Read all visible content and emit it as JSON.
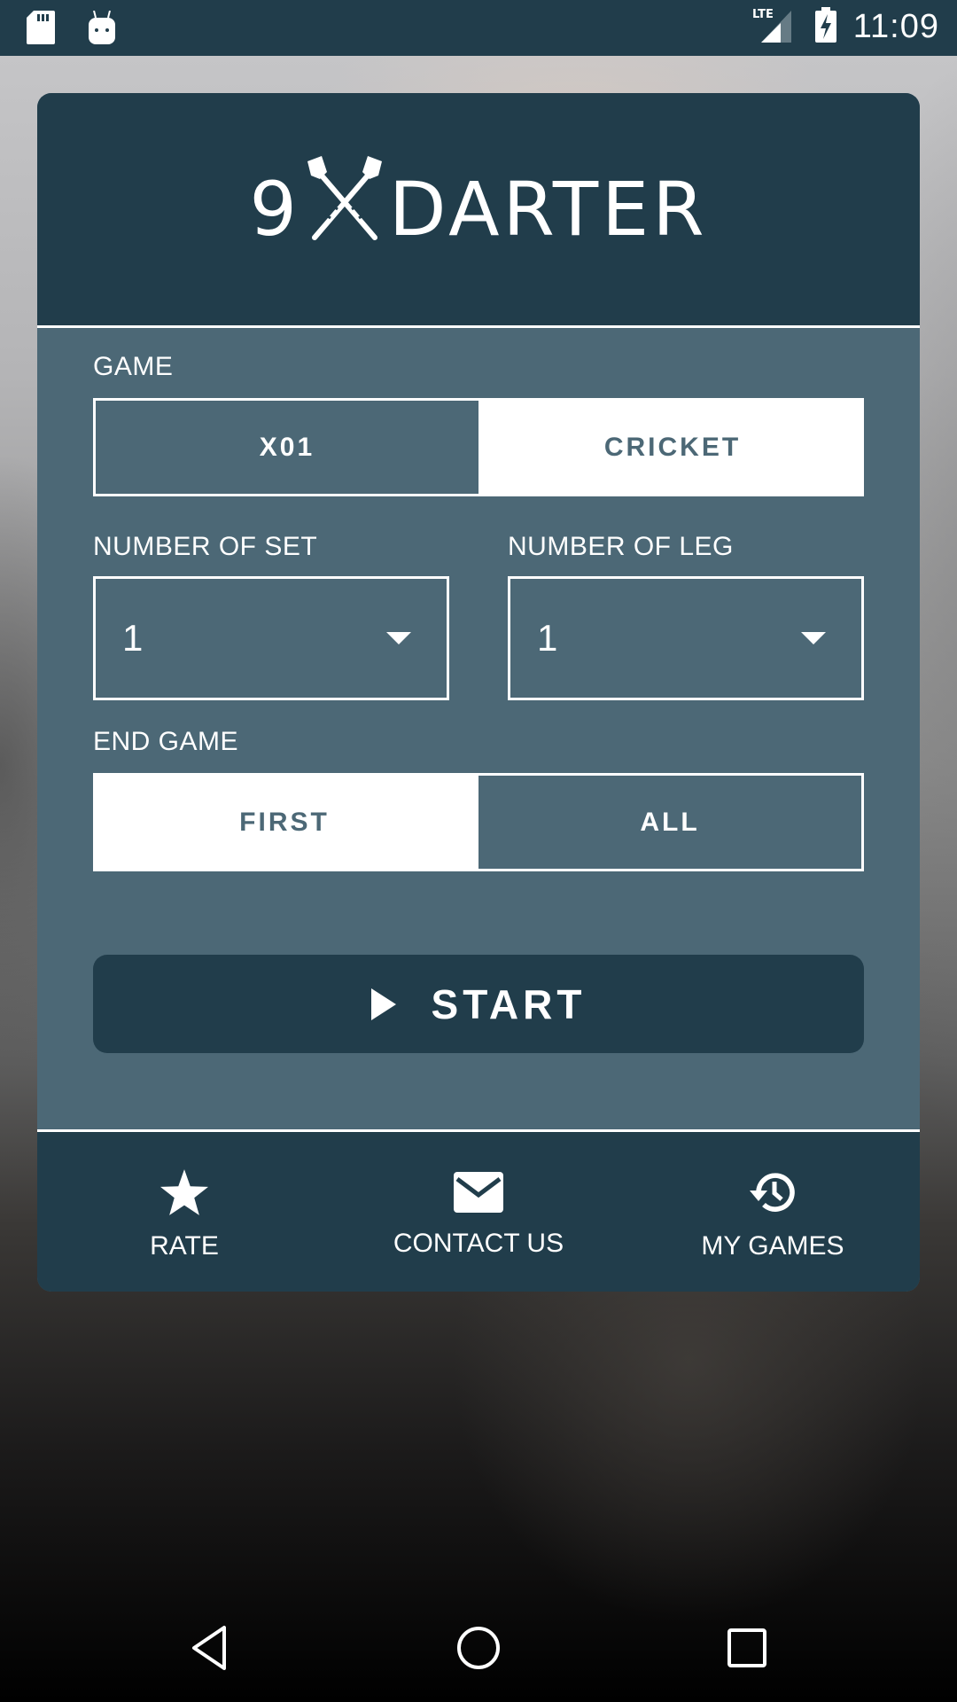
{
  "status_bar": {
    "time": "11:09",
    "network": "LTE",
    "left_icons": [
      "sd-card-icon",
      "android-debug-icon"
    ],
    "right_icons": [
      "lte-signal-icon",
      "battery-charging-icon"
    ]
  },
  "header": {
    "logo_number": "9",
    "logo_word": "DARTER",
    "logo_icon": "crossed-darts-icon"
  },
  "game": {
    "label": "GAME",
    "options": [
      {
        "label": "X01",
        "selected": true
      },
      {
        "label": "CRICKET",
        "selected": false
      }
    ]
  },
  "sets": {
    "label": "NUMBER OF SET",
    "value": "1"
  },
  "legs": {
    "label": "NUMBER OF LEG",
    "value": "1"
  },
  "end_game": {
    "label": "END GAME",
    "options": [
      {
        "label": "FIRST",
        "selected": false
      },
      {
        "label": "ALL",
        "selected": true
      }
    ]
  },
  "start_button": {
    "label": "START",
    "icon": "play-icon"
  },
  "footer": {
    "items": [
      {
        "label": "RATE",
        "icon": "star-icon"
      },
      {
        "label": "CONTACT US",
        "icon": "mail-icon"
      },
      {
        "label": "MY GAMES",
        "icon": "history-icon"
      }
    ]
  },
  "nav_bar": {
    "buttons": [
      "back",
      "home",
      "recents"
    ]
  },
  "colors": {
    "primary_dark": "#213d4b",
    "panel": "#4c6876",
    "text": "#ffffff"
  }
}
